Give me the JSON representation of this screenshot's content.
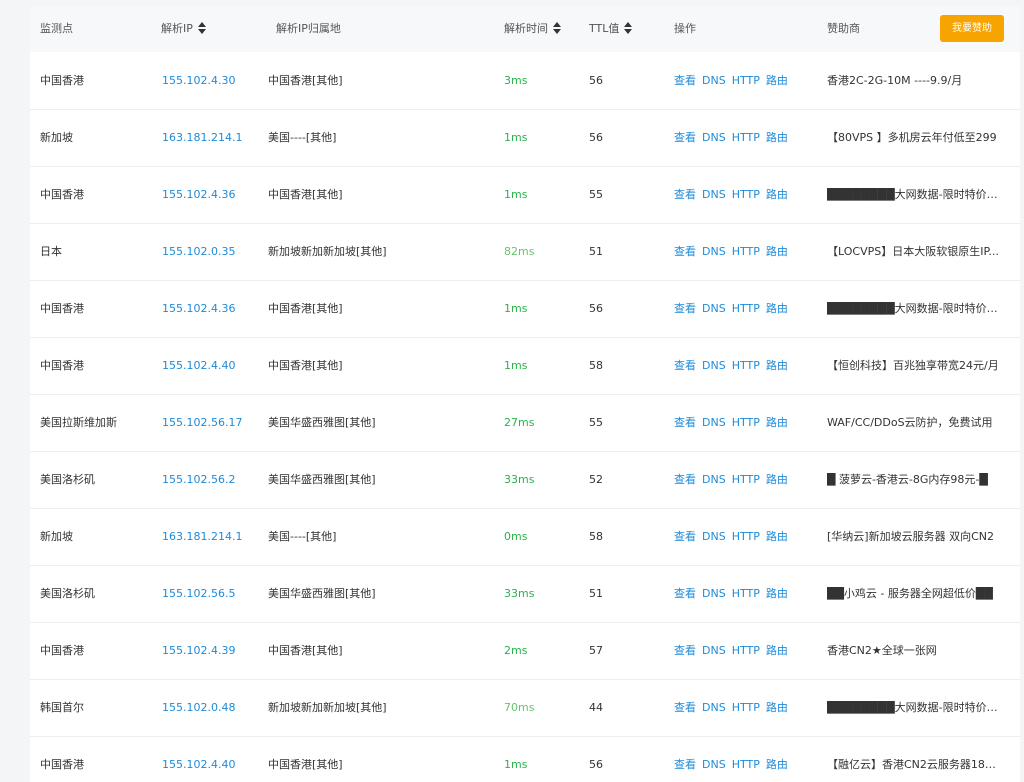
{
  "header": {
    "point": "监测点",
    "ip": "解析IP",
    "location": "解析IP归属地",
    "time": "解析时间",
    "ttl": "TTL值",
    "ops": "操作",
    "sponsor": "赞助商",
    "sponsor_button": "我要赞助"
  },
  "ops_labels": [
    "查看",
    "DNS",
    "HTTP",
    "路由"
  ],
  "colors": {
    "link": "#1e8bd9",
    "time_fast": "#2bb24c",
    "time_slow": "#69c26f",
    "button": "#f7a400"
  },
  "rows": [
    {
      "point": "中国香港",
      "ip": "155.102.4.30",
      "location": "中国香港[其他]",
      "time": "3ms",
      "ttl": "56",
      "sponsor": "香港2C-2G-10M ----9.9/月"
    },
    {
      "point": "新加坡",
      "ip": "163.181.214.1",
      "location": "美国----[其他]",
      "time": "1ms",
      "ttl": "56",
      "sponsor": "【80VPS 】多机房云年付低至299"
    },
    {
      "point": "中国香港",
      "ip": "155.102.4.36",
      "location": "中国香港[其他]",
      "time": "1ms",
      "ttl": "55",
      "sponsor": "████████大网数据-限时特价██"
    },
    {
      "point": "日本",
      "ip": "155.102.0.35",
      "location": "新加坡新加新加坡[其他]",
      "time": "82ms",
      "ttl": "51",
      "sponsor": "【LOCVPS】日本大阪软银原生IP..."
    },
    {
      "point": "中国香港",
      "ip": "155.102.4.36",
      "location": "中国香港[其他]",
      "time": "1ms",
      "ttl": "56",
      "sponsor": "████████大网数据-限时特价██"
    },
    {
      "point": "中国香港",
      "ip": "155.102.4.40",
      "location": "中国香港[其他]",
      "time": "1ms",
      "ttl": "58",
      "sponsor": "【恒创科技】百兆独享带宽24元/月"
    },
    {
      "point": "美国拉斯维加斯",
      "ip": "155.102.56.17",
      "location": "美国华盛西雅图[其他]",
      "time": "27ms",
      "ttl": "55",
      "sponsor": "WAF/CC/DDoS云防护，免费试用"
    },
    {
      "point": "美国洛杉矶",
      "ip": "155.102.56.2",
      "location": "美国华盛西雅图[其他]",
      "time": "33ms",
      "ttl": "52",
      "sponsor": "█ 菠萝云-香港云-8G内存98元-█"
    },
    {
      "point": "新加坡",
      "ip": "163.181.214.1",
      "location": "美国----[其他]",
      "time": "0ms",
      "ttl": "58",
      "sponsor": "[华纳云]新加坡云服务器 双向CN2"
    },
    {
      "point": "美国洛杉矶",
      "ip": "155.102.56.5",
      "location": "美国华盛西雅图[其他]",
      "time": "33ms",
      "ttl": "51",
      "sponsor": "██小鸡云 - 服务器全网超低价██"
    },
    {
      "point": "中国香港",
      "ip": "155.102.4.39",
      "location": "中国香港[其他]",
      "time": "2ms",
      "ttl": "57",
      "sponsor": "香港CN2★全球一张网"
    },
    {
      "point": "韩国首尔",
      "ip": "155.102.0.48",
      "location": "新加坡新加新加坡[其他]",
      "time": "70ms",
      "ttl": "44",
      "sponsor": "████████大网数据-限时特价██"
    },
    {
      "point": "中国香港",
      "ip": "155.102.4.40",
      "location": "中国香港[其他]",
      "time": "1ms",
      "ttl": "56",
      "sponsor": "【融亿云】香港CN2云服务器18元..."
    }
  ]
}
